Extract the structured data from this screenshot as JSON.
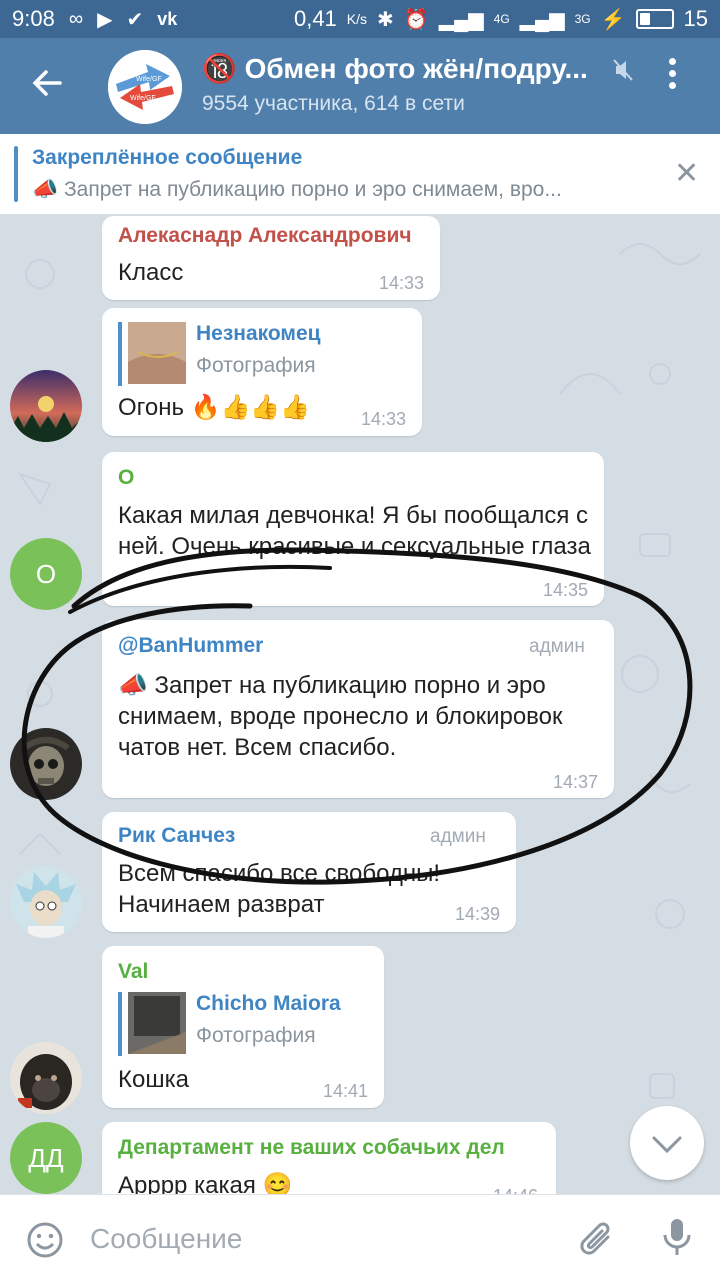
{
  "statusbar": {
    "time": "9:08",
    "speed": "0,41",
    "speed_unit": "K/s",
    "net1": "4G",
    "net2": "3G",
    "battery": "15"
  },
  "header": {
    "title": "🔞 Обмен фото жён/подру...",
    "subtitle": "9554 участника, 614 в сети",
    "avatar_text_1": "Wife/GF",
    "avatar_text_2": "Wife/GF"
  },
  "pinned": {
    "title": "Закреплённое сообщение",
    "text": "📣 Запрет на публикацию порно и эро снимаем, вро..."
  },
  "messages": [
    {
      "sender": "Алекаснадр Александрович",
      "text": "Класс",
      "time": "14:33",
      "color": "#c2514a"
    },
    {
      "reply_name": "Незнакомец",
      "reply_type": "Фотография",
      "text": "Огонь 🔥👍👍👍",
      "time": "14:33"
    },
    {
      "sender": "O",
      "text": "Какая милая девчонка!  Я бы пообщался с ней. Очень красивые и сексуальные глаза",
      "time": "14:35",
      "color": "#58b041",
      "avatar_letter": "O"
    },
    {
      "sender": "@BanHummer",
      "role": "админ",
      "text": "📣 Запрет на публикацию порно и эро снимаем, вроде пронесло и блокировок чатов нет. Всем спасибо.",
      "time": "14:37",
      "color": "#3f85c4"
    },
    {
      "sender": "Рик Санчез",
      "role": "админ",
      "text": "Всем спасибо все свободны! Начинаем разврат",
      "time": "14:39",
      "color": "#3f85c4"
    },
    {
      "sender": "Val",
      "reply_name": "Chicho Maiora",
      "reply_type": "Фотография",
      "text": "Кошка",
      "time": "14:41",
      "color": "#58b041"
    },
    {
      "sender": "Департамент не ваших собачьих дел",
      "text": "Арррр какая 😊",
      "time": "14:46",
      "color": "#58b041",
      "avatar_letter": "ДД"
    }
  ],
  "input": {
    "placeholder": "Сообщение"
  },
  "colors": {
    "header": "#507fab",
    "statusbar": "#3d6894",
    "chat_bg": "#d5dde4",
    "accent": "#3f85c4"
  }
}
